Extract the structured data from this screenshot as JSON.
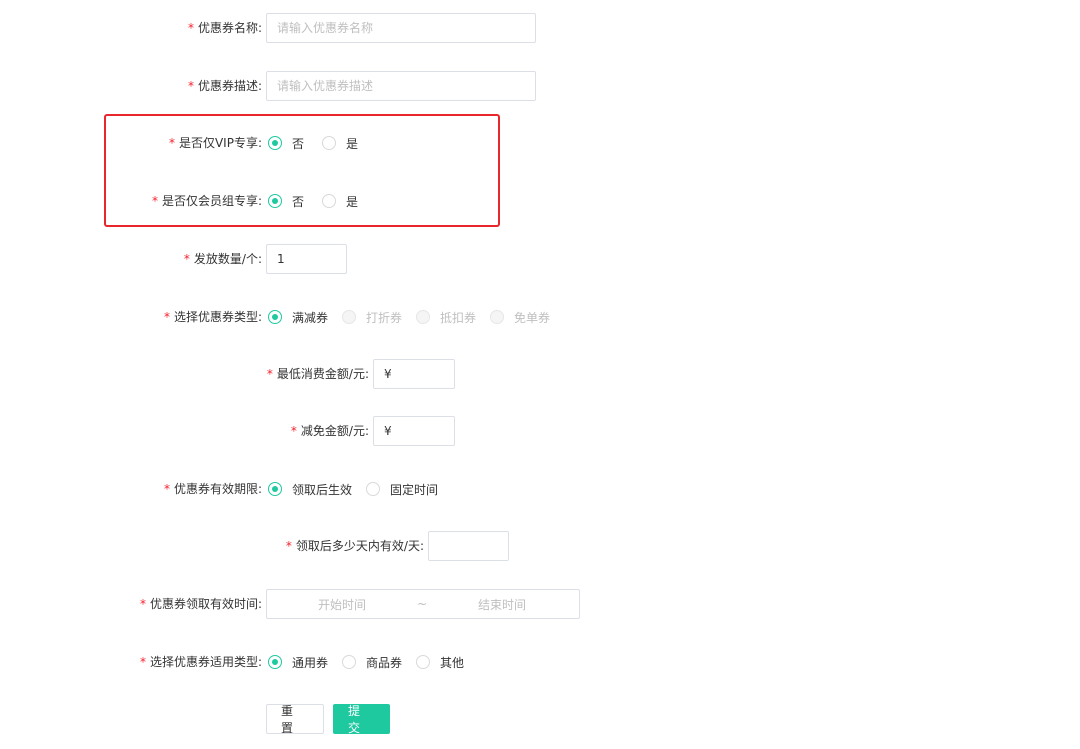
{
  "form": {
    "required_mark": "*",
    "coupon_name": {
      "label": "优惠券名称:",
      "placeholder": "请输入优惠券名称",
      "value": ""
    },
    "coupon_desc": {
      "label": "优惠券描述:",
      "placeholder": "请输入优惠券描述",
      "value": ""
    },
    "vip_only": {
      "label": "是否仅VIP专享:",
      "options": [
        "否",
        "是"
      ],
      "selected": "否"
    },
    "member_group_only": {
      "label": "是否仅会员组专享:",
      "options": [
        "否",
        "是"
      ],
      "selected": "否"
    },
    "issue_count": {
      "label": "发放数量/个:",
      "value": "1"
    },
    "coupon_type": {
      "label": "选择优惠券类型:",
      "options": [
        "满减券",
        "打折券",
        "抵扣券",
        "免单券"
      ],
      "selected": "满减券",
      "disabled": [
        "打折券",
        "抵扣券",
        "免单券"
      ]
    },
    "min_spend": {
      "label": "最低消费金额/元:",
      "value": "¥"
    },
    "discount_amount": {
      "label": "减免金额/元:",
      "value": "¥"
    },
    "validity": {
      "label": "优惠券有效期限:",
      "options": [
        "领取后生效",
        "固定时间"
      ],
      "selected": "领取后生效"
    },
    "valid_days": {
      "label": "领取后多少天内有效/天:",
      "value": ""
    },
    "claim_period": {
      "label": "优惠券领取有效时间:",
      "start_placeholder": "开始时间",
      "separator": "~",
      "end_placeholder": "结束时间"
    },
    "scope": {
      "label": "选择优惠券适用类型:",
      "options": [
        "通用券",
        "商品券",
        "其他"
      ],
      "selected": "通用券"
    },
    "buttons": {
      "reset": "重 置",
      "submit": "提 交"
    }
  },
  "colors": {
    "accent": "#1ec9a0",
    "required": "#f5222d",
    "highlight_box": "#e8262b"
  }
}
